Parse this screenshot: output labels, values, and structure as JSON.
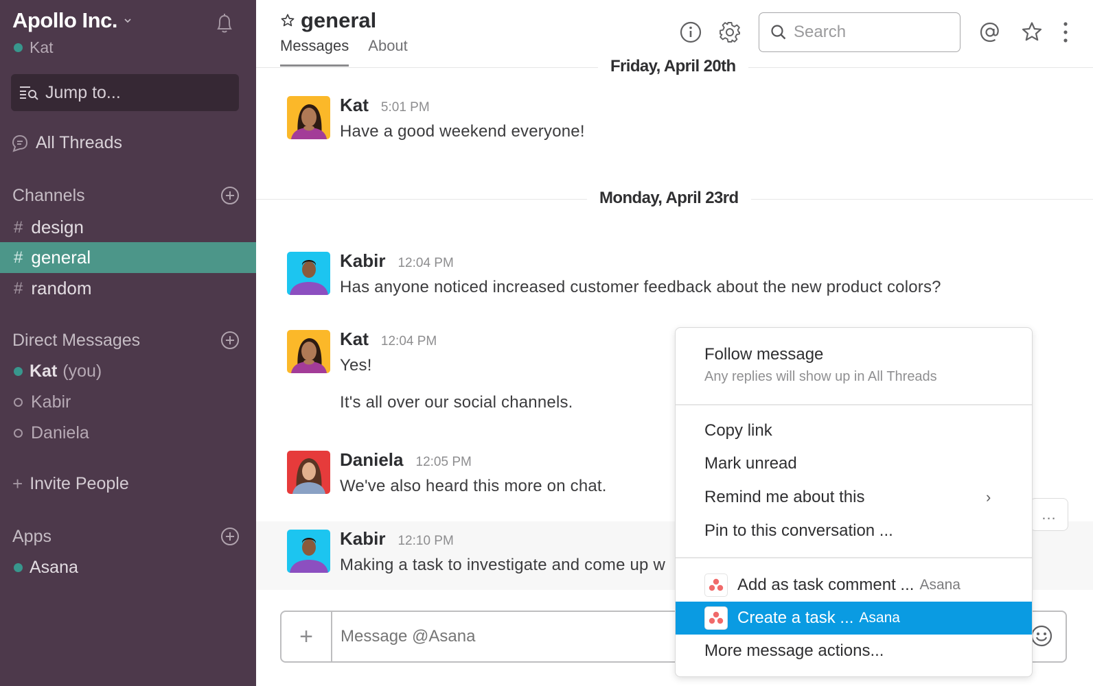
{
  "sidebar": {
    "team_name": "Apollo Inc.",
    "user_name": "Kat",
    "jump_to": "Jump to...",
    "all_threads": "All Threads",
    "channels_header": "Channels",
    "channels": [
      {
        "name": "design",
        "active": false
      },
      {
        "name": "general",
        "active": true
      },
      {
        "name": "random",
        "active": false
      }
    ],
    "dm_header": "Direct Messages",
    "dms": [
      {
        "name": "Kat",
        "suffix": "(you)",
        "online": true
      },
      {
        "name": "Kabir",
        "suffix": "",
        "online": false
      },
      {
        "name": "Daniela",
        "suffix": "",
        "online": false
      }
    ],
    "invite": "Invite People",
    "apps_header": "Apps",
    "apps": [
      {
        "name": "Asana",
        "online": true
      }
    ],
    "colors": {
      "background": "#4d394b",
      "active": "#4c9689",
      "presence": "#38978d"
    }
  },
  "header": {
    "channel": "general",
    "tabs": [
      {
        "label": "Messages",
        "active": true
      },
      {
        "label": "About",
        "active": false
      }
    ],
    "search_placeholder": "Search"
  },
  "days": [
    {
      "label": "Friday, April 20th"
    },
    {
      "label": "Monday, April 23rd"
    }
  ],
  "messages": [
    {
      "author": "Kat",
      "time": "5:01 PM",
      "lines": [
        "Have a good weekend everyone!"
      ],
      "avatar_color": "#fbb829"
    },
    {
      "author": "Kabir",
      "time": "12:04 PM",
      "lines": [
        "Has anyone noticed increased customer feedback about the new product colors?"
      ],
      "avatar_color": "#1cc5f0"
    },
    {
      "author": "Kat",
      "time": "12:04 PM",
      "lines": [
        "Yes!",
        "It's all over our social channels."
      ],
      "avatar_color": "#fbb829"
    },
    {
      "author": "Daniela",
      "time": "12:05 PM",
      "lines": [
        "We've also heard this more on chat."
      ],
      "avatar_color": "#e63b3b"
    },
    {
      "author": "Kabir",
      "time": "12:10 PM",
      "lines": [
        "Making a task to investigate and come up w"
      ],
      "avatar_color": "#1cc5f0"
    }
  ],
  "message_actions": {
    "more_label": "..."
  },
  "composer": {
    "placeholder": "Message @Asana",
    "add_label": "+"
  },
  "context_menu": {
    "follow": {
      "label": "Follow message",
      "sub": "Any replies will show up in All Threads"
    },
    "items": [
      {
        "label": "Copy link"
      },
      {
        "label": "Mark unread"
      },
      {
        "label": "Remind me about this",
        "submenu": "›"
      },
      {
        "label": "Pin to this conversation ..."
      }
    ],
    "app_items": [
      {
        "label": "Add as task comment ...",
        "app": "Asana",
        "selected": false
      },
      {
        "label": "Create a task ...",
        "app": "Asana",
        "selected": true
      }
    ],
    "more": {
      "label": "More message actions..."
    },
    "colors": {
      "selected": "#0a9be2",
      "asana": "#f06a6a"
    }
  }
}
